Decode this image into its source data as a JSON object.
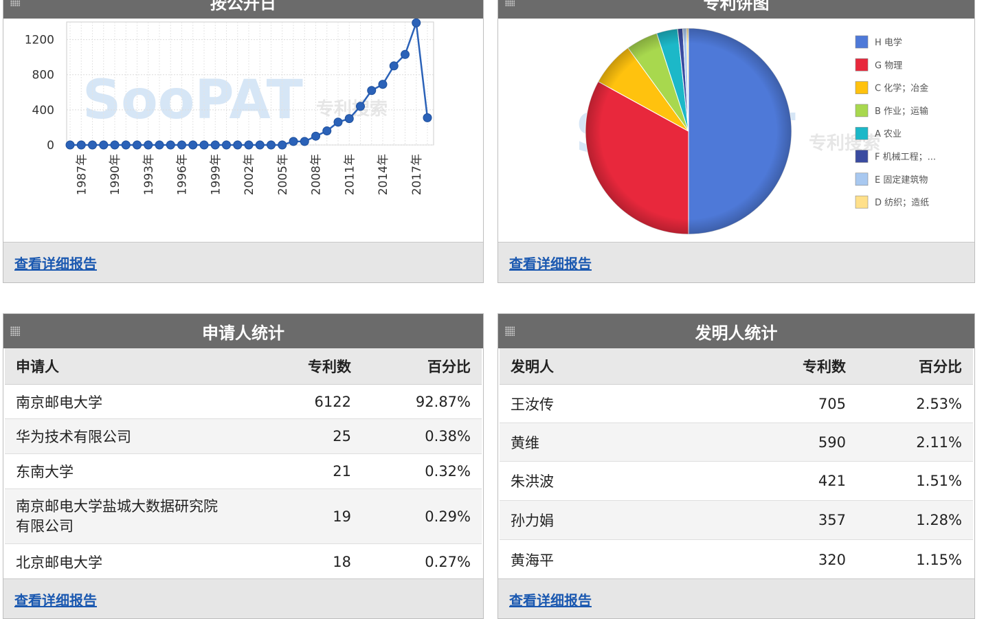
{
  "panels": {
    "trend": {
      "title": "按公开日",
      "link": "查看详细报告"
    },
    "pie": {
      "title": "专利饼图",
      "link": "查看详细报告"
    },
    "applicant": {
      "title": "申请人统计",
      "link": "查看详细报告"
    },
    "inventor": {
      "title": "发明人统计",
      "link": "查看详细报告"
    }
  },
  "watermark": {
    "brand": "SooPAT",
    "sub": "专利搜索"
  },
  "chart_data": [
    {
      "type": "line",
      "x": [
        "1986年",
        "1987年",
        "1988年",
        "1989年",
        "1990年",
        "1991年",
        "1992年",
        "1993年",
        "1994年",
        "1995年",
        "1996年",
        "1997年",
        "1998年",
        "1999年",
        "2000年",
        "2001年",
        "2002年",
        "2003年",
        "2004年",
        "2005年",
        "2006年",
        "2007年",
        "2008年",
        "2009年",
        "2010年",
        "2011年",
        "2012年",
        "2013年",
        "2014年",
        "2015年",
        "2016年",
        "2017年",
        "2018年"
      ],
      "x_tick_labels": [
        "1987年",
        "1990年",
        "1993年",
        "1996年",
        "1999年",
        "2002年",
        "2005年",
        "2008年",
        "2011年",
        "2014年",
        "2017年"
      ],
      "values": [
        0,
        0,
        0,
        0,
        0,
        0,
        0,
        0,
        0,
        0,
        0,
        0,
        0,
        0,
        0,
        0,
        0,
        0,
        0,
        0,
        40,
        40,
        100,
        160,
        260,
        300,
        440,
        620,
        690,
        900,
        1030,
        1390,
        310
      ],
      "y_ticks": [
        0,
        400,
        800,
        1200
      ],
      "ylim": [
        0,
        1400
      ],
      "grid": true,
      "color": "#2b62b8"
    },
    {
      "type": "pie",
      "series": [
        {
          "name": "H 电学",
          "value": 50.0,
          "color": "#4e79d8"
        },
        {
          "name": "G 物理",
          "value": 33.0,
          "color": "#e8283c"
        },
        {
          "name": "C 化学；冶金",
          "value": 7.0,
          "color": "#ffc20e"
        },
        {
          "name": "B 作业；运输",
          "value": 5.0,
          "color": "#a8d84e"
        },
        {
          "name": "A 农业",
          "value": 3.3,
          "color": "#1cb8c8"
        },
        {
          "name": "F 机械工程；...",
          "value": 0.8,
          "color": "#3a4ba0"
        },
        {
          "name": "E 固定建筑物",
          "value": 0.6,
          "color": "#a8c8f0"
        },
        {
          "name": "D 纺织；造纸",
          "value": 0.3,
          "color": "#ffe08a"
        }
      ],
      "legend": "right"
    }
  ],
  "applicant_table": {
    "headers": [
      "申请人",
      "专利数",
      "百分比"
    ],
    "rows": [
      {
        "name": "南京邮电大学",
        "count": "6122",
        "pct": "92.87%"
      },
      {
        "name": "华为技术有限公司",
        "count": "25",
        "pct": "0.38%"
      },
      {
        "name": "东南大学",
        "count": "21",
        "pct": "0.32%"
      },
      {
        "name": "南京邮电大学盐城大数据研究院有限公司",
        "count": "19",
        "pct": "0.29%"
      },
      {
        "name": "北京邮电大学",
        "count": "18",
        "pct": "0.27%"
      }
    ]
  },
  "inventor_table": {
    "headers": [
      "发明人",
      "专利数",
      "百分比"
    ],
    "rows": [
      {
        "name": "王汝传",
        "count": "705",
        "pct": "2.53%"
      },
      {
        "name": "黄维",
        "count": "590",
        "pct": "2.11%"
      },
      {
        "name": "朱洪波",
        "count": "421",
        "pct": "1.51%"
      },
      {
        "name": "孙力娟",
        "count": "357",
        "pct": "1.28%"
      },
      {
        "name": "黄海平",
        "count": "320",
        "pct": "1.15%"
      }
    ]
  }
}
